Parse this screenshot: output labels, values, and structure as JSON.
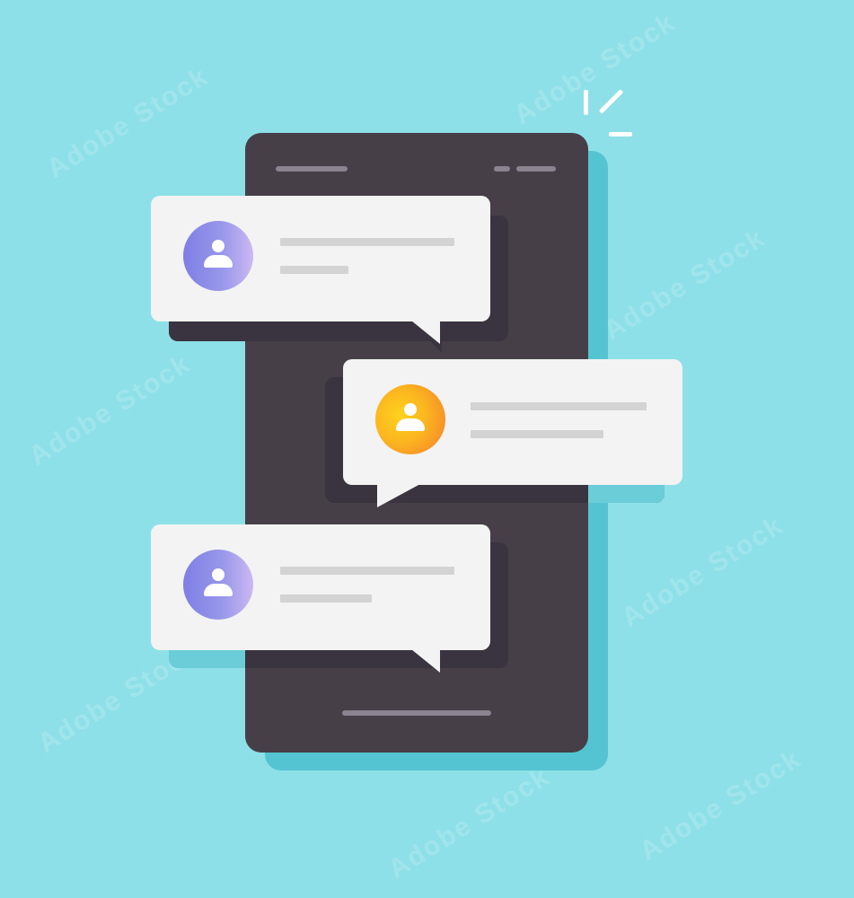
{
  "illustration": {
    "background_color": "#8ee0e8",
    "phone_color": "#463f48",
    "bubble_color": "#f3f3f3",
    "icons": [
      "user-avatar-icon",
      "spark-icon"
    ]
  },
  "messages": [
    {
      "avatar_color": "blue",
      "icon": "user-icon"
    },
    {
      "avatar_color": "orange",
      "icon": "user-icon"
    },
    {
      "avatar_color": "blue",
      "icon": "user-icon"
    }
  ],
  "watermark": {
    "text": "Adobe Stock"
  }
}
